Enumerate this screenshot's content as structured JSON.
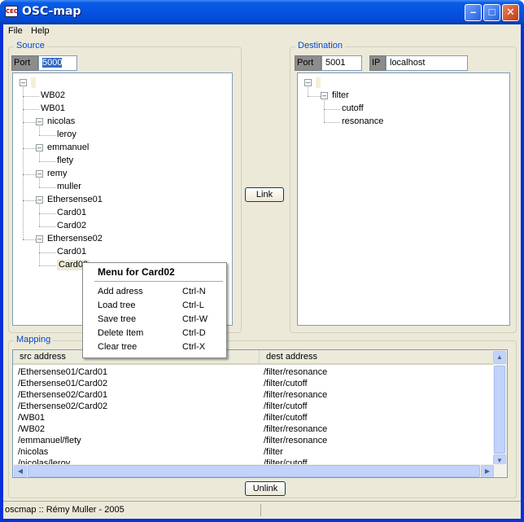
{
  "window": {
    "title": "OSC-map",
    "icon": "CEC"
  },
  "menubar": [
    "File",
    "Help"
  ],
  "source": {
    "group_label": "Source",
    "port_label": "Port",
    "port_value": "5000",
    "tree": [
      {
        "label": "",
        "level": 0
      },
      {
        "label": "WB02",
        "level": 1
      },
      {
        "label": "WB01",
        "level": 1
      },
      {
        "label": "nicolas",
        "level": 1
      },
      {
        "label": "leroy",
        "level": 2
      },
      {
        "label": "emmanuel",
        "level": 1
      },
      {
        "label": "flety",
        "level": 2
      },
      {
        "label": "remy",
        "level": 1
      },
      {
        "label": "muller",
        "level": 2
      },
      {
        "label": "Ethersense01",
        "level": 1
      },
      {
        "label": "Card01",
        "level": 2
      },
      {
        "label": "Card02",
        "level": 2
      },
      {
        "label": "Ethersense02",
        "level": 1
      },
      {
        "label": "Card01",
        "level": 2
      },
      {
        "label": "Card02",
        "level": 2
      }
    ]
  },
  "link_button": "Link",
  "destination": {
    "group_label": "Destination",
    "port_label": "Port",
    "port_value": "5001",
    "ip_label": "IP",
    "ip_value": "localhost",
    "tree": [
      {
        "label": "",
        "level": 0
      },
      {
        "label": "filter",
        "level": 1
      },
      {
        "label": "cutoff",
        "level": 2
      },
      {
        "label": "resonance",
        "level": 2
      }
    ]
  },
  "context_menu": {
    "title": "Menu for Card02",
    "items": [
      {
        "label": "Add adress",
        "shortcut": "Ctrl-N"
      },
      {
        "label": "Load tree",
        "shortcut": "Ctrl-L"
      },
      {
        "label": "Save tree",
        "shortcut": "Ctrl-W"
      },
      {
        "label": "Delete Item",
        "shortcut": "Ctrl-D"
      },
      {
        "label": "Clear tree",
        "shortcut": "Ctrl-X"
      }
    ]
  },
  "mapping": {
    "group_label": "Mapping",
    "columns": [
      "src address",
      "dest address"
    ],
    "rows": [
      [
        "/Ethersense01/Card01",
        "/filter/resonance"
      ],
      [
        "/Ethersense01/Card02",
        "/filter/cutoff"
      ],
      [
        "/Ethersense02/Card01",
        "/filter/resonance"
      ],
      [
        "/Ethersense02/Card02",
        "/filter/cutoff"
      ],
      [
        "/WB01",
        "/filter/cutoff"
      ],
      [
        "/WB02",
        "/filter/resonance"
      ],
      [
        "/emmanuel/flety",
        "/filter/resonance"
      ],
      [
        "/nicolas",
        "/filter"
      ],
      [
        "/nicolas/leroy",
        "/filter/cutoff"
      ]
    ],
    "unlink_button": "Unlink"
  },
  "statusbar": {
    "text": "oscmap :: Rémy Muller - 2005"
  }
}
